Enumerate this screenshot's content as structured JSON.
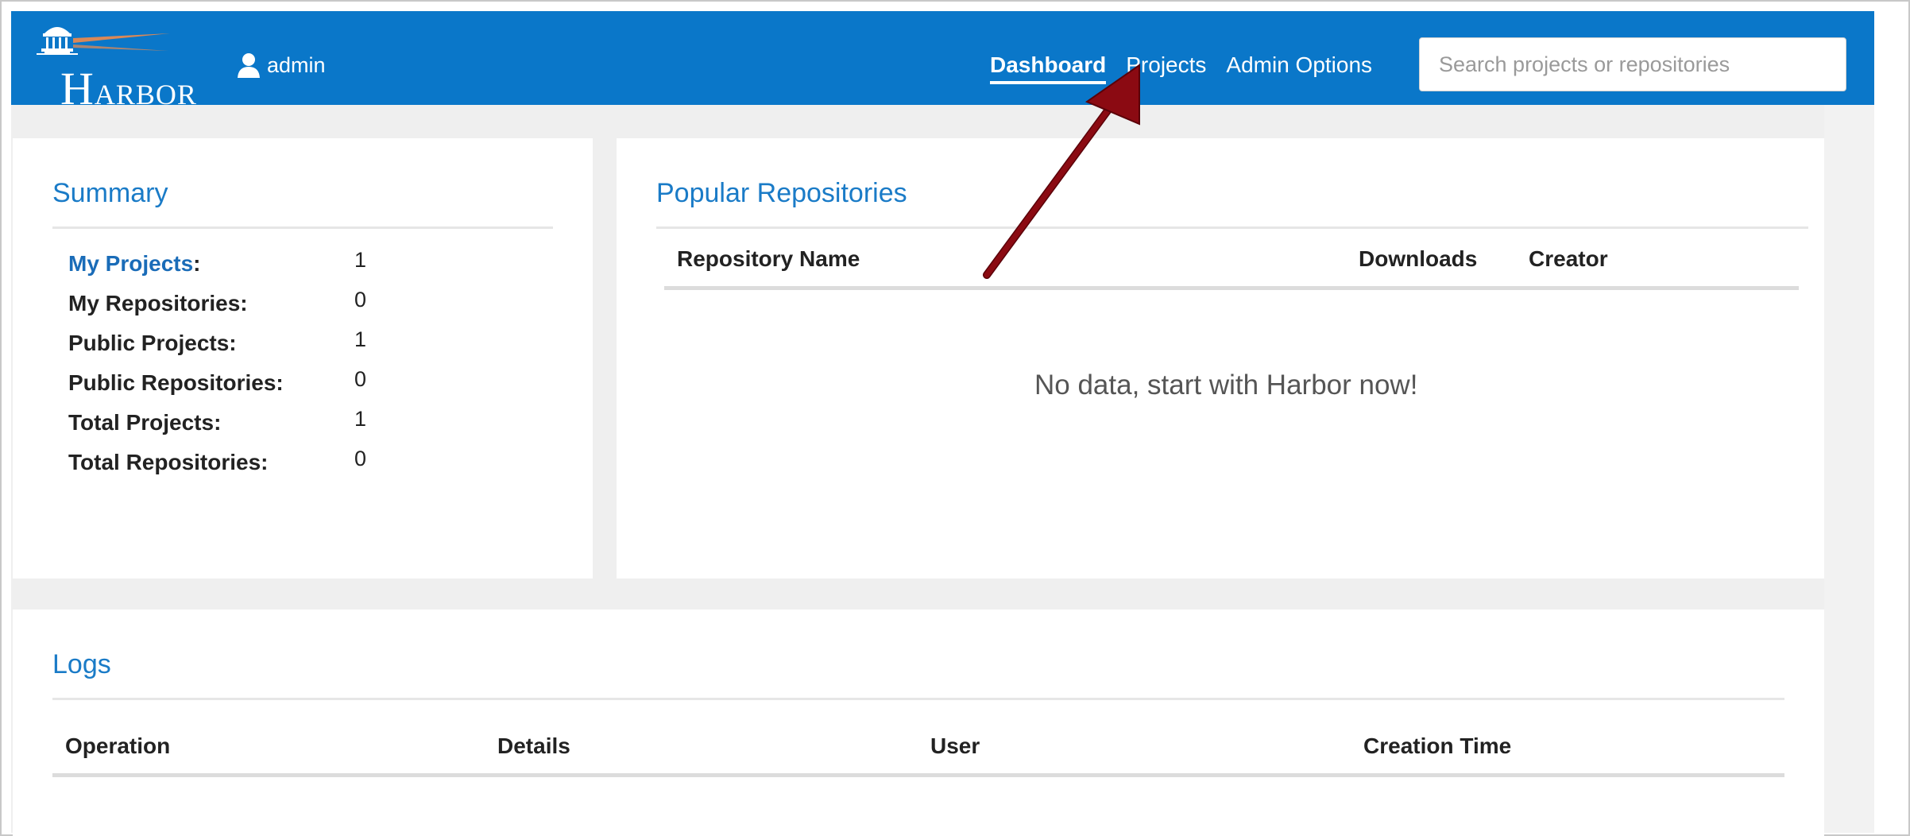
{
  "header": {
    "logo_first": "H",
    "logo_rest": "ARBOR",
    "username": "admin",
    "nav": [
      {
        "label": "Dashboard",
        "active": true
      },
      {
        "label": "Projects",
        "active": false
      },
      {
        "label": "Admin Options",
        "active": false
      }
    ],
    "search_placeholder": "Search projects or repositories"
  },
  "summary": {
    "title": "Summary",
    "items": [
      {
        "label": "My Projects",
        "suffix": ":",
        "value": "1",
        "is_link": true
      },
      {
        "label": "My Repositories:",
        "value": "0"
      },
      {
        "label": "Public Projects:",
        "value": "1"
      },
      {
        "label": "Public Repositories:",
        "value": "0"
      },
      {
        "label": "Total Projects:",
        "value": "1"
      },
      {
        "label": "Total Repositories:",
        "value": "0"
      }
    ]
  },
  "popular": {
    "title": "Popular Repositories",
    "columns": [
      "Repository Name",
      "Downloads",
      "Creator"
    ],
    "empty_message": "No data, start with Harbor now!"
  },
  "logs": {
    "title": "Logs",
    "columns": [
      "Operation",
      "Details",
      "User",
      "Creation Time"
    ]
  },
  "colors": {
    "navbar": "#0a77c9",
    "title_blue": "#1a7bc7",
    "link_blue": "#1a6cb8",
    "arrow": "#8b0a12"
  }
}
